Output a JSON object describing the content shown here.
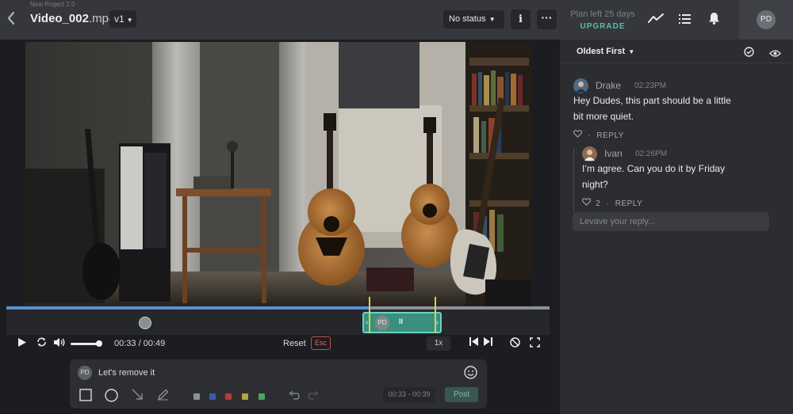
{
  "header": {
    "back_icon": "chevron-left-icon",
    "project_name": "New Project 2.0",
    "video_name": "Video_002",
    "video_ext": ".mp4",
    "version": "v1",
    "status": "No status",
    "info_icon": "info-icon",
    "more_icon": "more-horizontal-icon",
    "plan_text": "Plan left 25 days",
    "upgrade_label": "UPGRADE",
    "activity_icon": "activity-icon",
    "list_icon": "list-icon",
    "bell_icon": "bell-icon",
    "user_initials": "PD"
  },
  "player": {
    "progress": 0.673,
    "marker_avatar_icon": "user-avatar-marker",
    "range_initials": "PD",
    "range_pause": "II",
    "current_time": "00:33",
    "duration": "00:49",
    "time_separator": "/",
    "reset_label": "Reset",
    "esc_label": "Esc",
    "speed": "1x",
    "play_icon": "play-icon",
    "loop_icon": "loop-icon",
    "volume_icon": "volume-icon",
    "volume_level": 0.9,
    "prev_icon": "skip-back-icon",
    "next_icon": "skip-forward-icon",
    "draw_off_icon": "draw-off-icon",
    "fullscreen_icon": "fullscreen-icon"
  },
  "composer": {
    "initials": "PD",
    "text": "Let's remove it",
    "emoji_icon": "emoji-icon",
    "tools": [
      "rectangle-icon",
      "circle-icon",
      "arrow-icon",
      "pen-icon"
    ],
    "colors": [
      "#8d9096",
      "#3b5bb0",
      "#b83a3a",
      "#b3a540",
      "#4aa866"
    ],
    "undo_icon": "undo-icon",
    "redo_icon": "redo-icon",
    "time_range": "00:33 - 00:39",
    "post_label": "Post"
  },
  "comments": {
    "sort_label": "Oldest First",
    "check_icon": "check-circle-icon",
    "eye_icon": "eye-icon",
    "items": [
      {
        "author": "Drake",
        "time": "02:23PM",
        "body_line1": "Hey Dudes, this part should be a little",
        "body_line2": "bit more quiet.",
        "likes": "",
        "reply_label": "REPLY"
      },
      {
        "author": "Ivan",
        "time": "02:26PM",
        "body_line1": "I’m agree. Can you do it by Friday",
        "body_line2": "night?",
        "likes": "2",
        "reply_label": "REPLY"
      }
    ],
    "reply_placeholder": "Levave your reply..."
  },
  "colors": {
    "accent_teal": "#52c0a6",
    "progress_blue": "#5b8fd0",
    "esc_red": "#c74a4a"
  }
}
